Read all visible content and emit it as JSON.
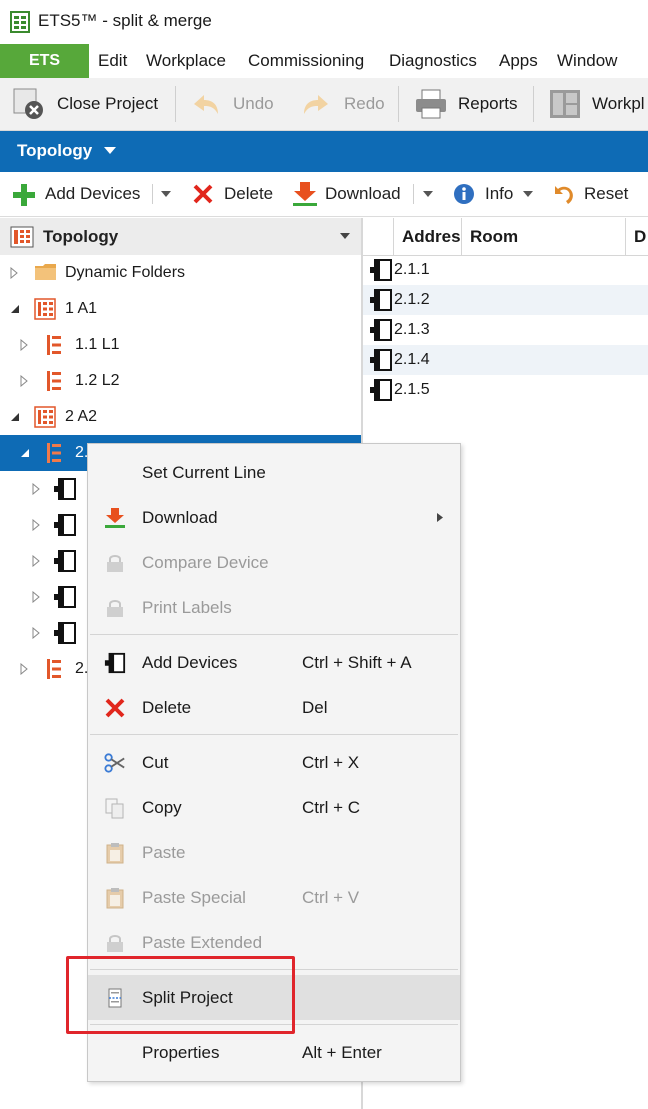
{
  "window": {
    "title": "ETS5™ - split & merge"
  },
  "menubar": {
    "ets_label": "ETS",
    "items": [
      "Edit",
      "Workplace",
      "Commissioning",
      "Diagnostics",
      "Apps",
      "Window"
    ]
  },
  "toolbar": {
    "close_project": "Close Project",
    "undo": "Undo",
    "redo": "Redo",
    "reports": "Reports",
    "workplace": "Workpl"
  },
  "topology_bar": {
    "label": "Topology"
  },
  "actions": {
    "add_devices": "Add Devices",
    "delete": "Delete",
    "download": "Download",
    "info": "Info",
    "reset": "Reset"
  },
  "tree": {
    "header": "Topology",
    "items": [
      {
        "label": "Dynamic Folders"
      },
      {
        "label": "1 A1"
      },
      {
        "label": "1.1 L1"
      },
      {
        "label": "1.2 L2"
      },
      {
        "label": "2 A2"
      },
      {
        "label": "2."
      },
      {
        "label": ""
      },
      {
        "label": ""
      },
      {
        "label": ""
      },
      {
        "label": ""
      },
      {
        "label": ""
      },
      {
        "label": "2."
      }
    ]
  },
  "grid": {
    "columns": [
      "Addres",
      "Room",
      "D"
    ],
    "rows": [
      "2.1.1",
      "2.1.2",
      "2.1.3",
      "2.1.4",
      "2.1.5"
    ]
  },
  "context_menu": {
    "items": [
      {
        "label": "Set Current Line",
        "shortcut": ""
      },
      {
        "label": "Download",
        "shortcut": ""
      },
      {
        "label": "Compare Device",
        "shortcut": ""
      },
      {
        "label": "Print Labels",
        "shortcut": ""
      },
      {
        "label": "Add Devices",
        "shortcut": "Ctrl + Shift + A"
      },
      {
        "label": "Delete",
        "shortcut": "Del"
      },
      {
        "label": "Cut",
        "shortcut": "Ctrl + X"
      },
      {
        "label": "Copy",
        "shortcut": "Ctrl + C"
      },
      {
        "label": "Paste",
        "shortcut": ""
      },
      {
        "label": "Paste Special",
        "shortcut": "Ctrl + V"
      },
      {
        "label": "Paste Extended",
        "shortcut": ""
      },
      {
        "label": "Split Project",
        "shortcut": ""
      },
      {
        "label": "Properties",
        "shortcut": "Alt + Enter"
      }
    ]
  },
  "colors": {
    "ets_green": "#57a83a",
    "topology_blue": "#0e6bb5",
    "highlight_red": "#e0252b"
  }
}
